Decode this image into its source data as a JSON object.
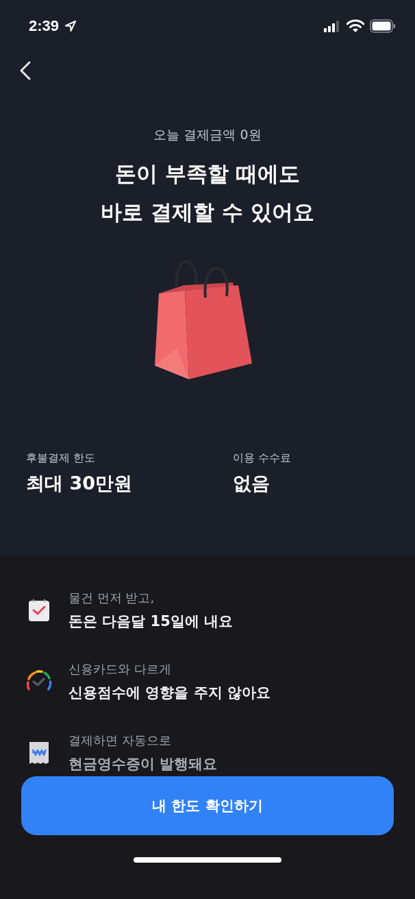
{
  "status_bar": {
    "time": "2:39"
  },
  "header": {
    "subtitle": "오늘 결제금액 0원",
    "title_lines": [
      "돈이 부족할 때에도",
      "바로 결제할 수 있어요"
    ]
  },
  "stats": [
    {
      "label": "후불결제 한도",
      "value": "최대 30만원"
    },
    {
      "label": "이용 수수료",
      "value": "없음"
    }
  ],
  "features": [
    {
      "kind": "calendar",
      "caption": "물건 먼저 받고,",
      "headline": "돈은 다음달 15일에 내요"
    },
    {
      "kind": "gauge",
      "caption": "신용카드와 다르게",
      "headline": "신용점수에 영향을 주지 않아요"
    },
    {
      "kind": "receipt",
      "caption": "결제하면 자동으로",
      "headline": "현금영수증이 발행돼요"
    }
  ],
  "cta_button": {
    "label": "내 한도 확인하기"
  }
}
